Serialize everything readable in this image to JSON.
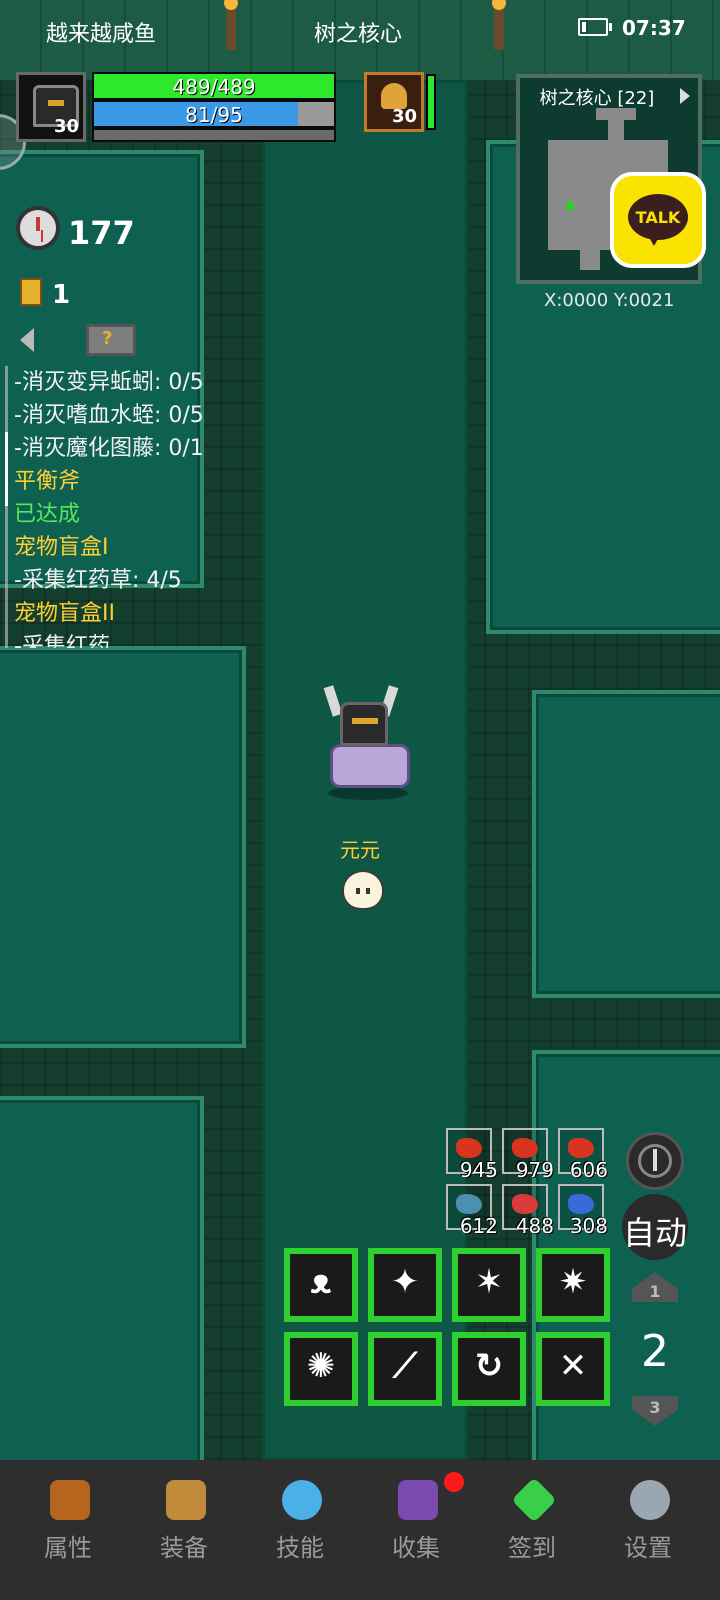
{
  "status_bar": {
    "left_text": "越来越咸鱼",
    "center_text": "树之核心",
    "time": "07:37"
  },
  "player": {
    "level": "30",
    "hp": "489/489",
    "mp": "81/95",
    "mp_fraction": 0.85
  },
  "pet_hud": {
    "level": "30"
  },
  "minimap": {
    "title": "树之核心 [22]",
    "coords": "X:0000  Y:0021"
  },
  "kakao": {
    "label": "TALK"
  },
  "counters": {
    "timer": "177",
    "keys": "1"
  },
  "quests": [
    {
      "text": "-消灭变异蚯蚓: 0/5",
      "color": "white"
    },
    {
      "text": "-消灭嗜血水蛭: 0/5",
      "color": "white"
    },
    {
      "text": "-消灭魔化图藤: 0/1",
      "color": "white"
    },
    {
      "text": "平衡斧",
      "color": "yellow"
    },
    {
      "text": "已达成",
      "color": "green"
    },
    {
      "text": "宠物盲盒I",
      "color": "yellow"
    },
    {
      "text": "-采集红药草: 4/5",
      "color": "white"
    },
    {
      "text": "宠物盲盒II",
      "color": "yellow"
    },
    {
      "text": "-采集红药",
      "color": "white"
    }
  ],
  "pet_name": "元元",
  "consumables": [
    {
      "icon": "meat-icon",
      "count": "945",
      "color": "#d9341f"
    },
    {
      "icon": "meat-icon",
      "count": "979",
      "color": "#d9341f"
    },
    {
      "icon": "meat-icon",
      "count": "606",
      "color": "#d9341f"
    },
    {
      "icon": "fish-icon",
      "count": "612",
      "color": "#4a90b0"
    },
    {
      "icon": "red-potion-icon",
      "count": "488",
      "color": "#d93a3a"
    },
    {
      "icon": "blue-potion-icon",
      "count": "308",
      "color": "#3a6ad9"
    }
  ],
  "skills": [
    {
      "icon": "summon-allies-icon",
      "glyph": "ᴥ"
    },
    {
      "icon": "war-cry-icon",
      "glyph": "✦"
    },
    {
      "icon": "rage-icon",
      "glyph": "✶"
    },
    {
      "icon": "berserk-icon",
      "glyph": "✷"
    },
    {
      "icon": "taunt-icon",
      "glyph": "✺"
    },
    {
      "icon": "sword-slash-icon",
      "glyph": "⟋"
    },
    {
      "icon": "whirlwind-icon",
      "glyph": "↻"
    },
    {
      "icon": "cross-strike-icon",
      "glyph": "✕"
    }
  ],
  "controls": {
    "auto_label": "自动",
    "page_up": "1",
    "page_current": "2",
    "page_down": "3"
  },
  "nav": [
    {
      "label": "属性",
      "icon": "helmet-icon",
      "color": "#b5651d"
    },
    {
      "label": "装备",
      "icon": "bag-icon",
      "color": "#c08a3a"
    },
    {
      "label": "技能",
      "icon": "crystal-icon",
      "color": "#4ab0e6"
    },
    {
      "label": "收集",
      "icon": "book-icon",
      "color": "#7a4ab0",
      "badge": true
    },
    {
      "label": "签到",
      "icon": "gem-icon",
      "color": "#3acf4a"
    },
    {
      "label": "设置",
      "icon": "gear-icon",
      "color": "#9aa6b0"
    }
  ]
}
